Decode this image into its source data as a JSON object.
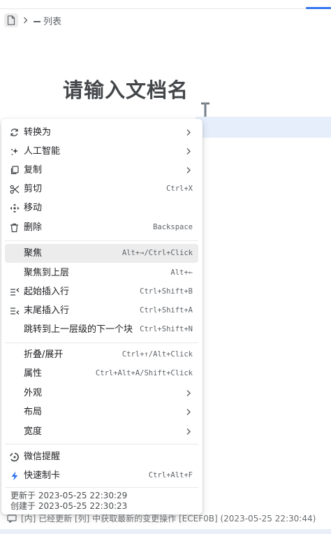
{
  "breadcrumb": {
    "items": [
      {
        "icon": "document-icon"
      },
      {
        "icon": "chevron-right-icon"
      },
      {
        "label": "列表"
      }
    ]
  },
  "document": {
    "title": "请输入文档名"
  },
  "menu": {
    "items": [
      {
        "icon": "refresh-icon",
        "label": "转换为",
        "submenu": true
      },
      {
        "icon": "sparkle-icon",
        "label": "人工智能",
        "submenu": true
      },
      {
        "icon": "copy-icon",
        "label": "复制",
        "submenu": true
      },
      {
        "icon": "scissors-icon",
        "label": "剪切",
        "shortcut": "Ctrl+X"
      },
      {
        "icon": "move-icon",
        "label": "移动"
      },
      {
        "icon": "trash-icon",
        "label": "删除",
        "shortcut": "Backspace"
      },
      {
        "label": "聚焦",
        "shortcut": "Alt+→/Ctrl+Click",
        "active": true
      },
      {
        "label": "聚焦到上层",
        "shortcut": "Alt+←"
      },
      {
        "icon": "insert-before-icon",
        "label": "起始插入行",
        "shortcut": "Ctrl+Shift+B"
      },
      {
        "icon": "insert-after-icon",
        "label": "末尾插入行",
        "shortcut": "Ctrl+Shift+A"
      },
      {
        "label": "跳转到上一层级的下一个块",
        "shortcut": "Ctrl+Shift+N"
      },
      {
        "label": "折叠/展开",
        "shortcut": "Ctrl+↑/Alt+Click"
      },
      {
        "label": "属性",
        "shortcut": "Ctrl+Alt+A/Shift+Click"
      },
      {
        "label": "外观",
        "submenu": true
      },
      {
        "label": "布局",
        "submenu": true
      },
      {
        "label": "宽度",
        "submenu": true
      },
      {
        "icon": "wechat-reminder-icon",
        "label": "微信提醒"
      },
      {
        "icon": "lightning-icon",
        "label": "快速制卡",
        "shortcut": "Ctrl+Alt+F"
      }
    ],
    "updated": "更新于 2023-05-25 22:30:29",
    "created": "创建于 2023-05-25 22:30:23"
  },
  "statusbar": {
    "text": "[内] 已经更新 [列] 中获取最新的变更操作 [ECEF0B] (2023-05-25 22:30:44)"
  },
  "colors": {
    "accent": "#3574f0",
    "selection": "#e6edfb",
    "active_item": "#ececec",
    "lightning": "#3574f0"
  }
}
